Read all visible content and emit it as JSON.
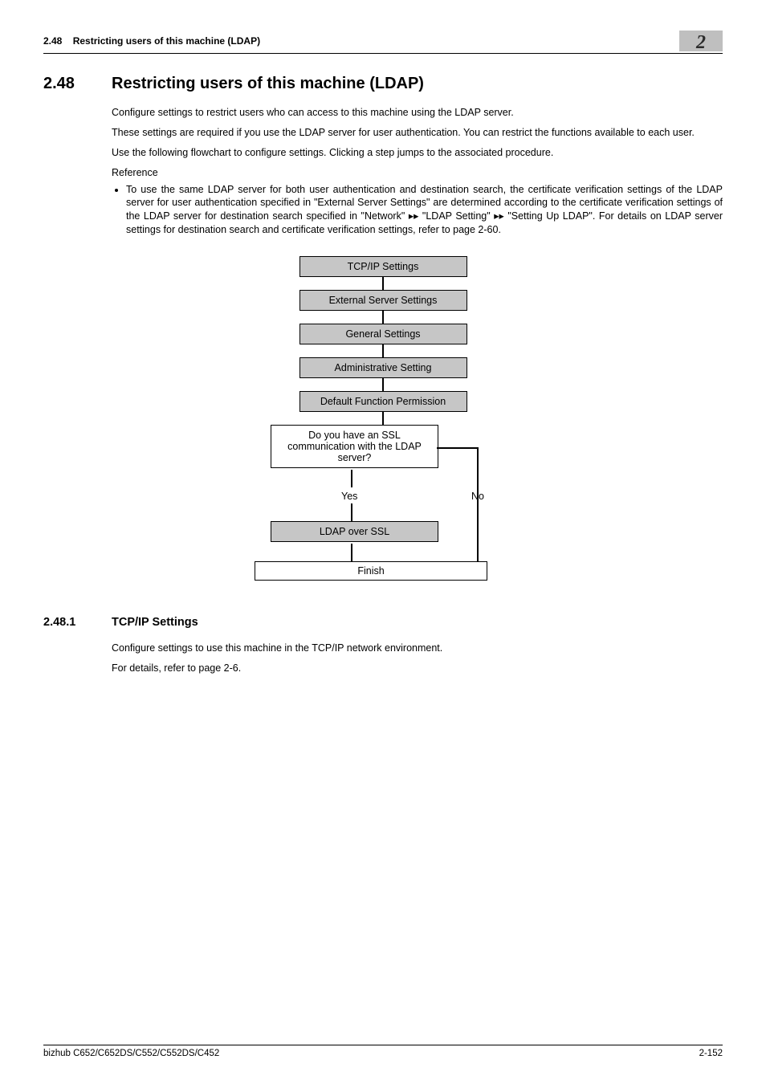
{
  "header": {
    "section_ref": "2.48",
    "section_name": "Restricting users of this machine (LDAP)",
    "chapter_num": "2"
  },
  "section": {
    "num": "2.48",
    "title": "Restricting users of this machine (LDAP)",
    "para1": "Configure settings to restrict users who can access to this machine using the LDAP server.",
    "para2": "These settings are required if you use the LDAP server for user authentication. You can restrict the functions available to each user.",
    "para3": "Use the following flowchart to configure settings. Clicking a step jumps to the associated procedure.",
    "ref_label": "Reference",
    "ref_bullet": "To use the same LDAP server for both user authentication and destination search, the certificate verification settings of the LDAP server for user authentication specified in \"External Server Settings\" are determined according to the certificate verification settings of the LDAP server for destination search specified in \"Network\" ▸▸ \"LDAP Setting\" ▸▸ \"Setting Up LDAP\". For details on LDAP server settings for destination search and certificate verification settings, refer to page 2-60."
  },
  "flowchart": {
    "n1": "TCP/IP Settings",
    "n2": "External Server Settings",
    "n3": "General Settings",
    "n4": "Administrative Setting",
    "n5": "Default Function Permission",
    "decision": "Do you have an SSL communication with the LDAP server?",
    "yes": "Yes",
    "no": "No",
    "n6": "LDAP over SSL",
    "finish": "Finish"
  },
  "subsection": {
    "num": "2.48.1",
    "title": "TCP/IP Settings",
    "para1": "Configure settings to use this machine in the TCP/IP network environment.",
    "para2": "For details, refer to page 2-6."
  },
  "footer": {
    "model": "bizhub C652/C652DS/C552/C552DS/C452",
    "page": "2-152"
  }
}
